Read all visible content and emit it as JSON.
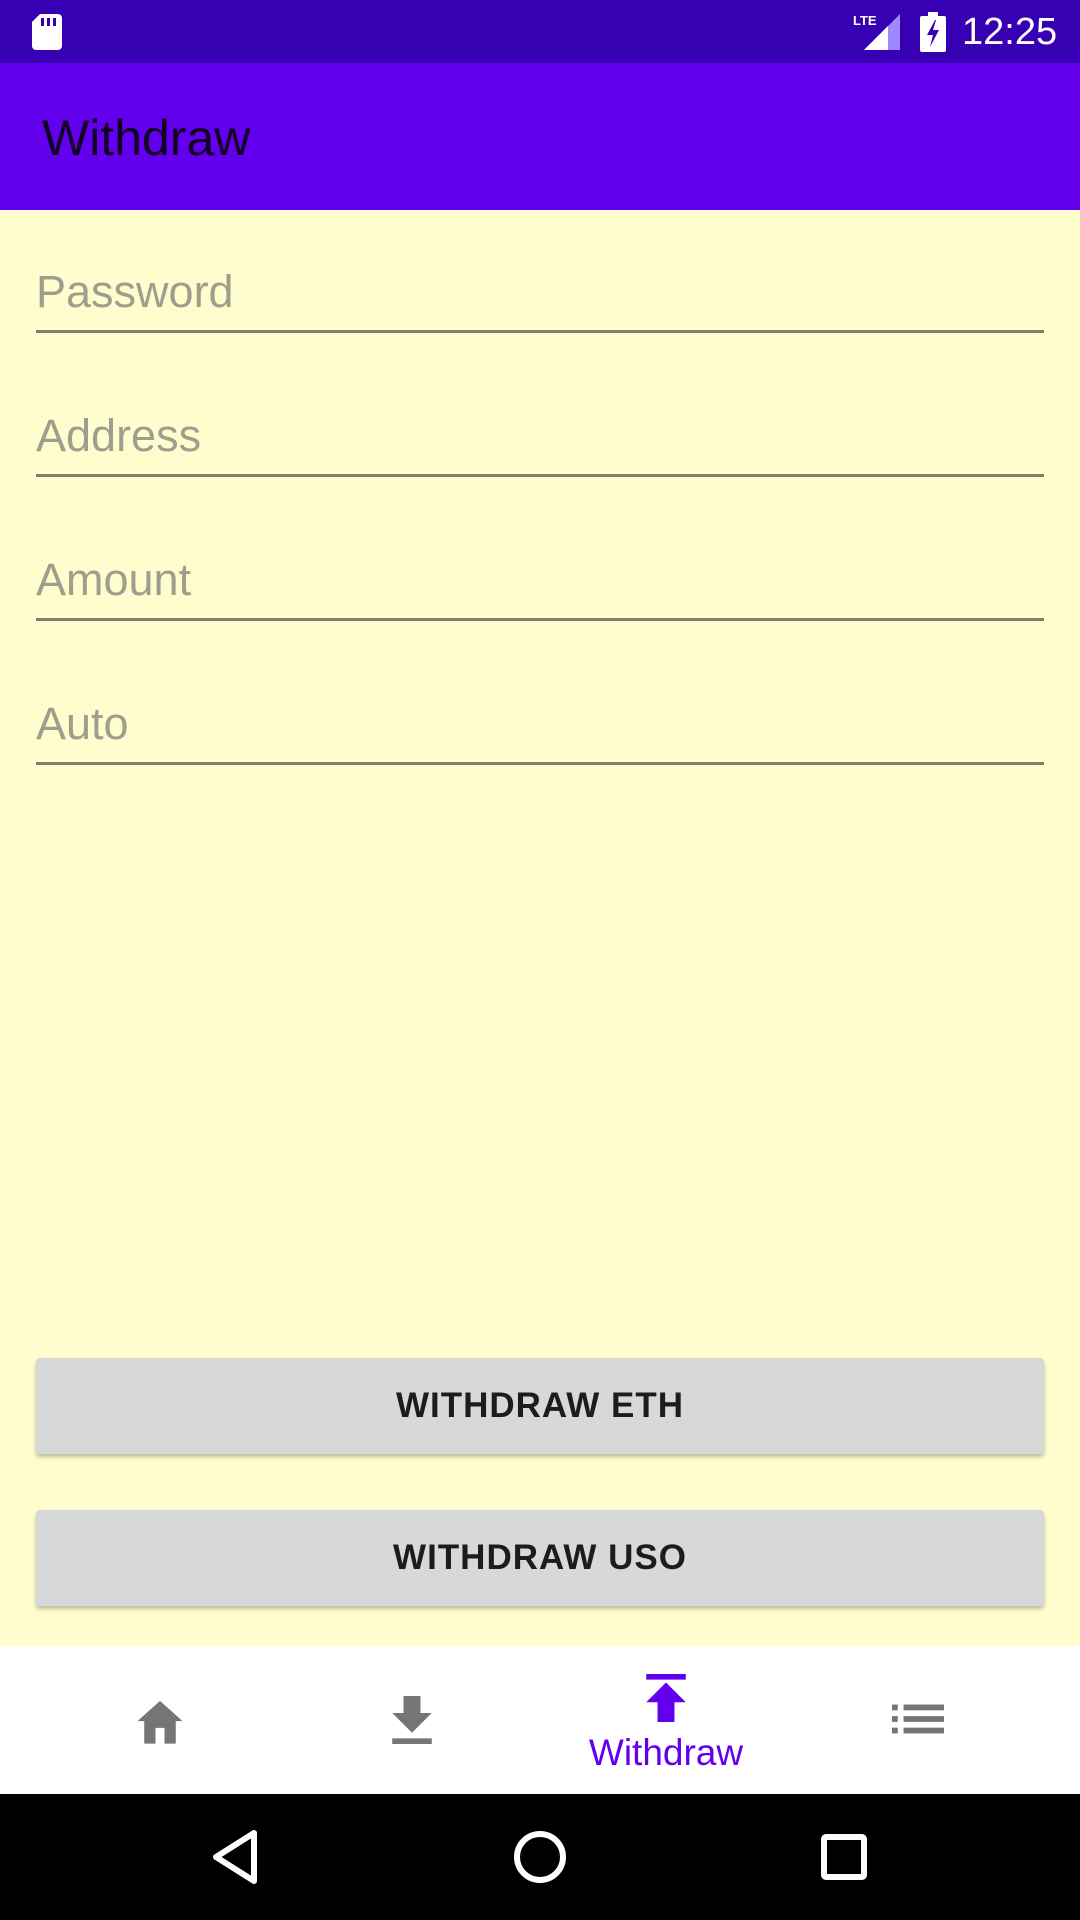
{
  "status_bar": {
    "time": "12:25",
    "network": "LTE",
    "icons": [
      "sd-card-icon",
      "lte-signal-icon",
      "battery-charging-icon"
    ]
  },
  "app_bar": {
    "title": "Withdraw"
  },
  "form": {
    "password": {
      "placeholder": "Password",
      "value": ""
    },
    "address": {
      "placeholder": "Address",
      "value": ""
    },
    "amount": {
      "placeholder": "Amount",
      "value": ""
    },
    "auto": {
      "placeholder": "Auto",
      "value": ""
    }
  },
  "buttons": {
    "withdraw_eth": "WITHDRAW ETH",
    "withdraw_uso": "WITHDRAW USO"
  },
  "bottom_nav": {
    "items": [
      {
        "icon": "home-icon",
        "label": "",
        "active": false
      },
      {
        "icon": "download-icon",
        "label": "",
        "active": false
      },
      {
        "icon": "upload-icon",
        "label": "Withdraw",
        "active": true
      },
      {
        "icon": "list-icon",
        "label": "",
        "active": false
      }
    ]
  },
  "system_nav": {
    "icons": [
      "back-icon",
      "home-circle-icon",
      "recents-icon"
    ]
  },
  "colors": {
    "status_bar": "#3700B3",
    "app_bar": "#6200EE",
    "background": "#FFFDCD",
    "button": "#D7D8D8",
    "nav_active": "#6200EE",
    "nav_inactive": "#757575"
  }
}
